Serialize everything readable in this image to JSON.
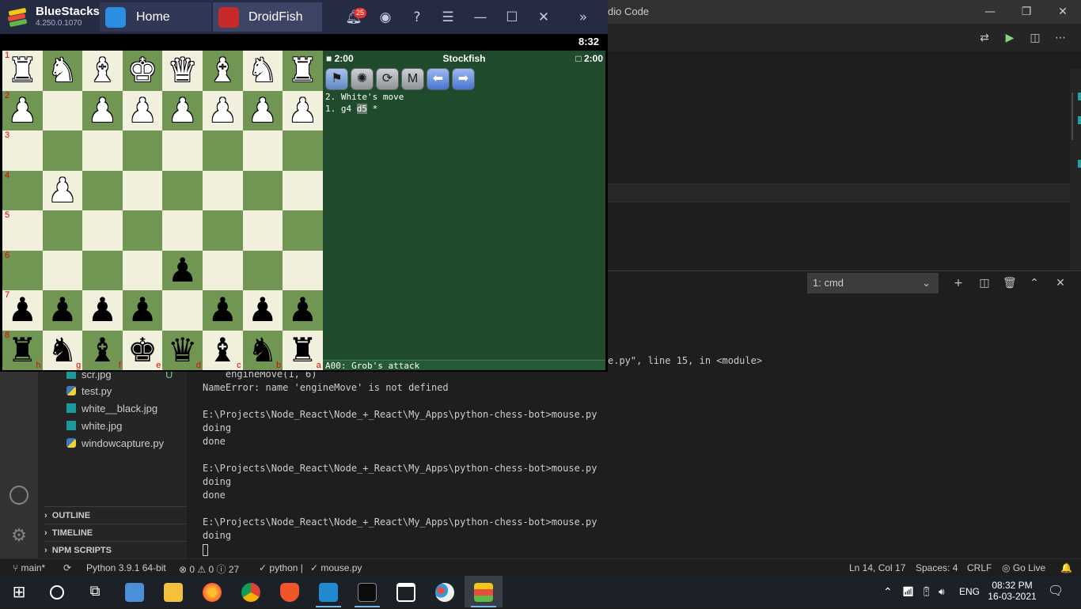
{
  "vscode": {
    "title_fragment": "dio Code",
    "terminal_select": "1: cmd",
    "sidebar_files": [
      {
        "name": "scr.jpg",
        "badge": "U",
        "type": "image"
      },
      {
        "name": "test.py",
        "type": "python"
      },
      {
        "name": "white__black.jpg",
        "type": "image"
      },
      {
        "name": "white.jpg",
        "type": "image"
      },
      {
        "name": "windowcapture.py",
        "type": "python"
      }
    ],
    "sidebar_sections": [
      "OUTLINE",
      "TIMELINE",
      "NPM SCRIPTS"
    ],
    "terminal_lines": [
      "e.py\", line 15, in <module>",
      "    engineMove(1, 6)",
      "NameError: name 'engineMove' is not defined",
      "",
      "E:\\Projects\\Node_React\\Node_+_React\\My_Apps\\python-chess-bot>mouse.py",
      "doing",
      "done",
      "",
      "E:\\Projects\\Node_React\\Node_+_React\\My_Apps\\python-chess-bot>mouse.py",
      "doing",
      "done",
      "",
      "E:\\Projects\\Node_React\\Node_+_React\\My_Apps\\python-chess-bot>mouse.py",
      "doing"
    ],
    "status": {
      "branch": "main*",
      "python": "Python 3.9.1 64-bit",
      "errors": "0",
      "warnings": "0",
      "infos": "27",
      "lang_check": "python |",
      "file_check": "mouse.py",
      "position": "Ln 14, Col 17",
      "spaces": "Spaces: 4",
      "eol": "CRLF",
      "golive": "Go Live"
    }
  },
  "bluestacks": {
    "name": "BlueStacks",
    "version": "4.250.0.1070",
    "tabs": [
      {
        "label": "Home"
      },
      {
        "label": "DroidFish"
      }
    ],
    "notification_count": "25",
    "android_time": "8:32"
  },
  "droidfish": {
    "white_clock": "2:00",
    "black_clock": "2:00",
    "engine": "Stockfish",
    "toolbar_m": "M",
    "move_status": "2. White's move",
    "move_list_num": "1. g4 ",
    "move_list_hl": "d5",
    "move_list_tail": " *",
    "opening": "A00: Grob's attack",
    "board": [
      [
        "♜",
        "♞",
        "♝",
        "♚",
        "♛",
        "♝",
        "♞",
        "♜"
      ],
      [
        "♟",
        "",
        "♟",
        "♟",
        "♟",
        "♟",
        "♟",
        "♟"
      ],
      [
        "",
        "",
        "",
        "",
        "",
        "",
        "",
        ""
      ],
      [
        "",
        "♟",
        "",
        "",
        "",
        "",
        "",
        ""
      ],
      [
        "",
        "",
        "",
        "",
        "",
        "",
        "",
        ""
      ],
      [
        "",
        "",
        "",
        "",
        "♟",
        "",
        "",
        ""
      ],
      [
        "♟",
        "♟",
        "♟",
        "♟",
        "",
        "♟",
        "♟",
        "♟"
      ],
      [
        "♜",
        "♞",
        "♝",
        "♚",
        "♛",
        "♝",
        "♞",
        "♜"
      ]
    ],
    "piece_colors": [
      "w",
      "w",
      "w",
      "w",
      "b",
      "b",
      "b",
      "b"
    ],
    "ranks": [
      "1",
      "2",
      "3",
      "4",
      "5",
      "6",
      "7",
      "8"
    ],
    "files": [
      "h",
      "g",
      "f",
      "e",
      "d",
      "c",
      "b",
      "a"
    ]
  },
  "taskbar": {
    "lang": "ENG",
    "time": "08:32 PM",
    "date": "16-03-2021"
  }
}
